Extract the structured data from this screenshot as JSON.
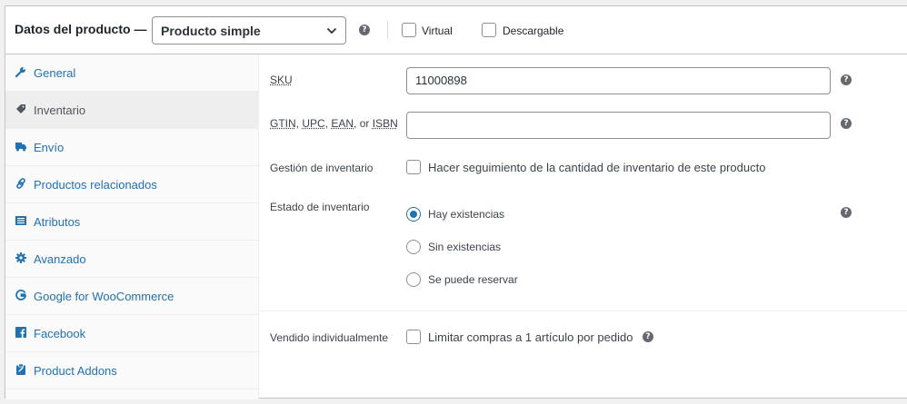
{
  "header": {
    "title": "Datos del producto —",
    "product_type": "Producto simple",
    "virtual_label": "Virtual",
    "downloadable_label": "Descargable"
  },
  "sidebar": {
    "items": [
      {
        "label": "General",
        "icon": "wrench-icon"
      },
      {
        "label": "Inventario",
        "icon": "tag-icon",
        "active": true
      },
      {
        "label": "Envío",
        "icon": "truck-icon"
      },
      {
        "label": "Productos relacionados",
        "icon": "link-icon"
      },
      {
        "label": "Atributos",
        "icon": "list-icon"
      },
      {
        "label": "Avanzado",
        "icon": "gear-icon"
      },
      {
        "label": "Google for WooCommerce",
        "icon": "google-icon"
      },
      {
        "label": "Facebook",
        "icon": "facebook-icon"
      },
      {
        "label": "Product Addons",
        "icon": "clipboard-icon"
      }
    ]
  },
  "inventory": {
    "sku_label": "SKU",
    "sku_value": "11000898",
    "gtin_label_parts": [
      "GTIN",
      "UPC",
      "EAN",
      "or",
      "ISBN"
    ],
    "gtin_value": "",
    "stock_mgmt_label": "Gestión de inventario",
    "stock_mgmt_checkbox_label": "Hacer seguimiento de la cantidad de inventario de este producto",
    "stock_status_label": "Estado de inventario",
    "stock_options": [
      "Hay existencias",
      "Sin existencias",
      "Se puede reservar"
    ],
    "stock_selected": "Hay existencias",
    "sold_individually_label": "Vendido individualmente",
    "sold_individually_checkbox_label": "Limitar compras a 1 artículo por pedido"
  },
  "colors": {
    "link": "#2271b1",
    "active_tab_bg": "#eeeeee",
    "border": "#c3c4c7"
  }
}
